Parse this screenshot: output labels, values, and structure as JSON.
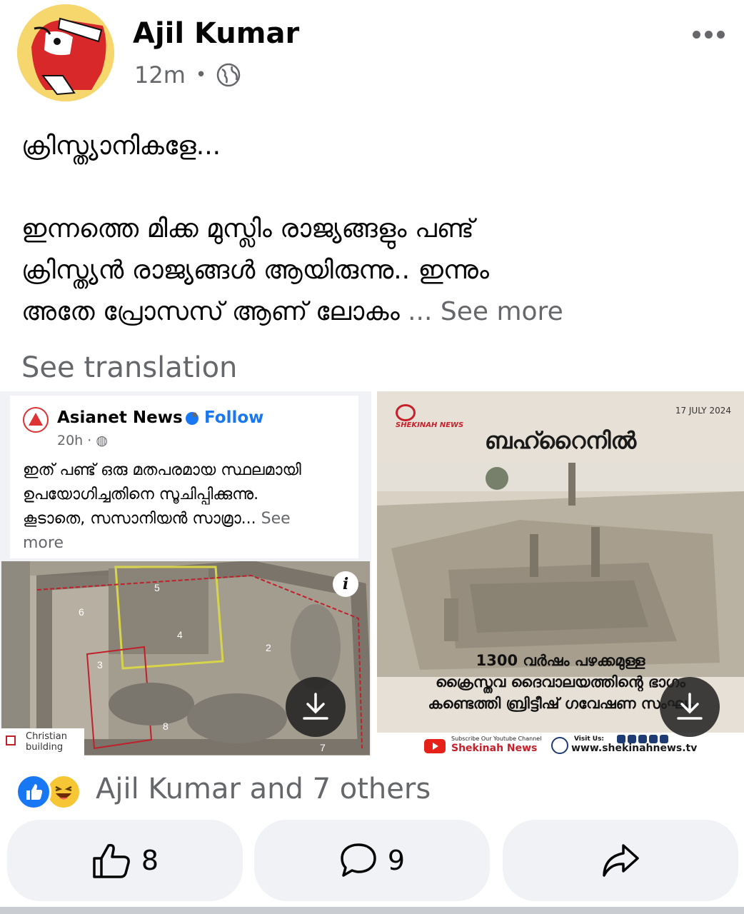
{
  "post": {
    "author": "Ajil Kumar",
    "time": "12m",
    "visibility_icon": "globe-icon",
    "text_line1": "ക്രിസ്ത്യാനികളേ...",
    "text_para2_line1": "ഇന്നത്തെ മിക്ക മുസ്ലിം രാജ്യങ്ങളും പണ്ട്",
    "text_para2_line2": "ക്രിസ്ത്യൻ രാജ്യങ്ങൾ ആയിരുന്നു.. ഇന്നും",
    "text_para2_line3": "അതേ പ്രോസസ് ആണ് ലോകം",
    "ellipsis": " ... ",
    "see_more": "See more",
    "see_translation": "See translation"
  },
  "embedded": {
    "page_name": "Asianet News",
    "follow": "Follow",
    "time": "20h ·",
    "text_line1": "ഇത് പണ്ട് ഒരു മതപരമായ സ്ഥലമായി",
    "text_line2": "ഉപയോഗിച്ചതിനെ സൂചിപ്പിക്കുന്നു.",
    "text_line3": "കൂടാതെ, സസാനിയൻ സാമ്രാ...",
    "see": "See",
    "more": "more",
    "legend": "Christian building",
    "labels": [
      "5",
      "6",
      "4",
      "3",
      "2",
      "8",
      "7"
    ]
  },
  "card": {
    "brand": "SHEKINAH NEWS",
    "date": "17 JULY 2024",
    "title": "ബഹ്റൈനിൽ",
    "caption_line1": "1300 വർഷം പഴക്കമുള്ള",
    "caption_line2": "ക്രൈസ്തവ ദൈവാലയത്തിന്റെ ഭാഗം",
    "caption_line3": "കണ്ടെത്തി ബ്രിട്ടീഷ് ഗവേഷണ സംഘം",
    "subscribe": "Subscribe Our Youtube Channel",
    "channel": "Shekinah News",
    "visit": "Visit Us:",
    "url": "www.shekinahnews.tv"
  },
  "reactions": {
    "icons": [
      "like-icon",
      "haha-icon"
    ],
    "text": "Ajil Kumar and 7 others"
  },
  "actions": {
    "likes": "8",
    "comments": "9"
  },
  "colors": {
    "link_blue": "#1877f2",
    "secondary_text": "#65676b",
    "button_bg": "#f0f2f5",
    "brand_red": "#c8202a"
  }
}
